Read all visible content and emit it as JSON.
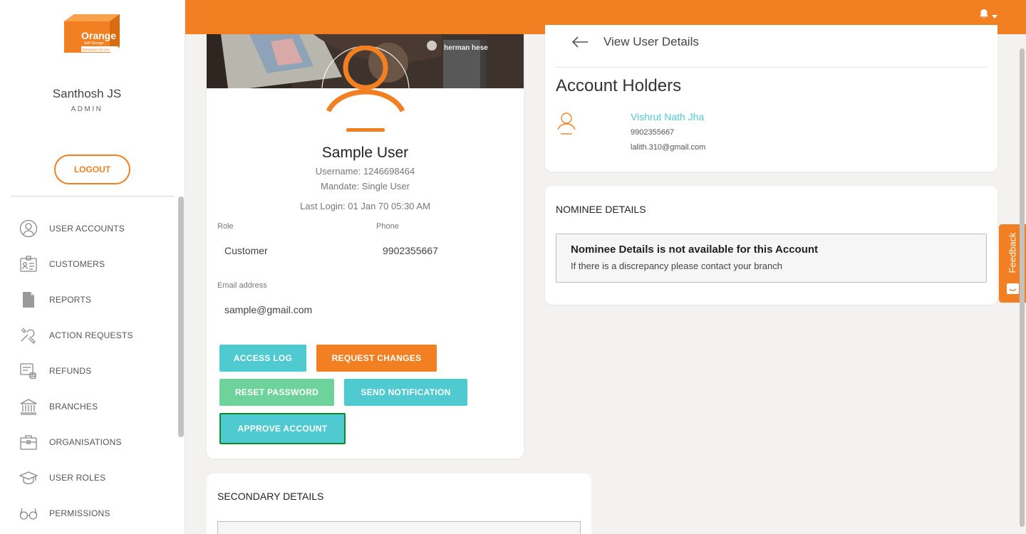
{
  "brand": {
    "name": "Orange",
    "tagline": "Self Storage",
    "slogan": "Extraspace for you",
    "accent_color": "#f28022",
    "teal_color": "#4fcad1",
    "green_color": "#6dd39b"
  },
  "sidebar": {
    "user_name": "Santhosh JS",
    "user_role": "ADMIN",
    "logout_label": "LOGOUT",
    "items": [
      {
        "label": "USER ACCOUNTS",
        "icon": "user-circle-icon"
      },
      {
        "label": "CUSTOMERS",
        "icon": "id-card-icon"
      },
      {
        "label": "REPORTS",
        "icon": "document-icon"
      },
      {
        "label": "ACTION REQUESTS",
        "icon": "tools-icon"
      },
      {
        "label": "REFUNDS",
        "icon": "refund-icon"
      },
      {
        "label": "BRANCHES",
        "icon": "bank-icon"
      },
      {
        "label": "ORGANISATIONS",
        "icon": "briefcase-icon"
      },
      {
        "label": "USER ROLES",
        "icon": "graduation-cap-icon"
      },
      {
        "label": "PERMISSIONS",
        "icon": "glasses-icon"
      }
    ]
  },
  "topbar": {
    "notification_icon": "bell-icon"
  },
  "profile": {
    "name": "Sample User",
    "username": "Username: 1246698464",
    "mandate": "Mandate: Single User",
    "last_login": "Last Login: 01 Jan 70 05:30 AM",
    "role_label": "Role",
    "role_value": "Customer",
    "phone_label": "Phone",
    "phone_value": "9902355667",
    "email_label": "Email address",
    "email_value": "sample@gmail.com",
    "cover_text": "herman hese"
  },
  "actions": {
    "access_log": "ACCESS LOG",
    "request_changes": "REQUEST CHANGES",
    "reset_password": "RESET PASSWORD",
    "send_notification": "SEND NOTIFICATION",
    "approve_account": "APPROVE ACCOUNT"
  },
  "secondary": {
    "title": "SECONDARY DETAILS"
  },
  "details": {
    "page_title": "View User Details",
    "holders_heading": "Account Holders",
    "holder": {
      "name": "Vishrut Nath Jha",
      "phone": "9902355667",
      "email": "lalith.310@gmail.com"
    }
  },
  "nominee": {
    "title": "NOMINEE DETAILS",
    "message_title": "Nominee Details is not available for this Account",
    "message_text": "If there is a discrepancy please contact your branch"
  },
  "feedback": {
    "label": "Feedback"
  }
}
